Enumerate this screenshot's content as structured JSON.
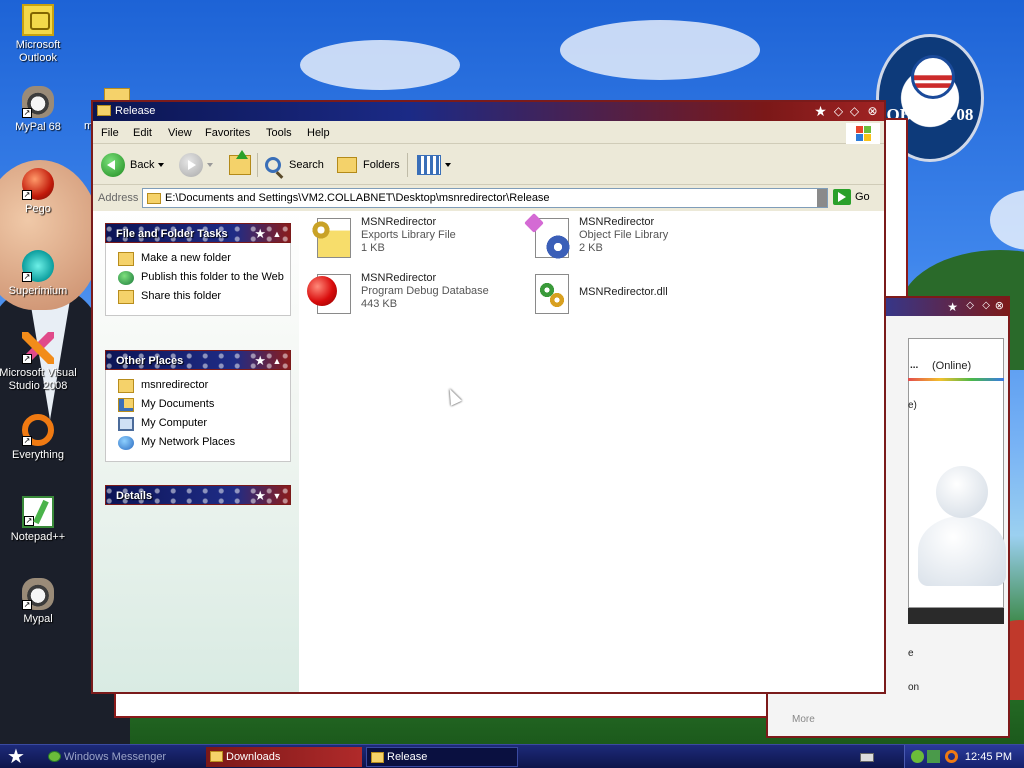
{
  "desktop": {
    "icons": [
      {
        "label": "Microsoft Outlook"
      },
      {
        "label": "MyPal 68"
      },
      {
        "label": "Pego"
      },
      {
        "label": "Superimium"
      },
      {
        "label": "Microsoft Visual Studio 2008"
      },
      {
        "label": "Everything"
      },
      {
        "label": "Notepad++"
      },
      {
        "label": "Mypal"
      }
    ],
    "truncated_label": "m",
    "wallpaper_badge": "OBAMA'08"
  },
  "window": {
    "title": "Release",
    "menu": [
      "File",
      "Edit",
      "View",
      "Favorites",
      "Tools",
      "Help"
    ],
    "toolbar": {
      "back": "Back",
      "search": "Search",
      "folders": "Folders"
    },
    "address": {
      "label": "Address",
      "value": "E:\\Documents and Settings\\VM2.COLLABNET\\Desktop\\msnredirector\\Release",
      "go": "Go"
    },
    "tasks": {
      "file_folder": {
        "title": "File and Folder Tasks",
        "items": [
          "Make a new folder",
          "Publish this folder to the Web",
          "Share this folder"
        ]
      },
      "other_places": {
        "title": "Other Places",
        "items": [
          "msnredirector",
          "My Documents",
          "My Computer",
          "My Network Places"
        ]
      },
      "details": {
        "title": "Details"
      }
    },
    "files": [
      {
        "name": "MSNRedirector",
        "type": "Exports Library File",
        "size": "1 KB",
        "icon": "exports-library-icon"
      },
      {
        "name": "MSNRedirector",
        "type": "Object File Library",
        "size": "2 KB",
        "icon": "object-library-icon"
      },
      {
        "name": "MSNRedirector",
        "type": "Program Debug Database",
        "size": "443 KB",
        "icon": "debug-database-icon"
      },
      {
        "name": "MSNRedirector.dll",
        "type": "",
        "size": "",
        "icon": "dll-icon"
      }
    ]
  },
  "messenger": {
    "status": "(Online)",
    "fragments": [
      "...",
      "o",
      "e)",
      "e",
      "on",
      "More"
    ]
  },
  "taskbar": {
    "tasks": [
      "Windows Messenger",
      "Downloads",
      "Release"
    ],
    "clock": "12:45 PM"
  }
}
